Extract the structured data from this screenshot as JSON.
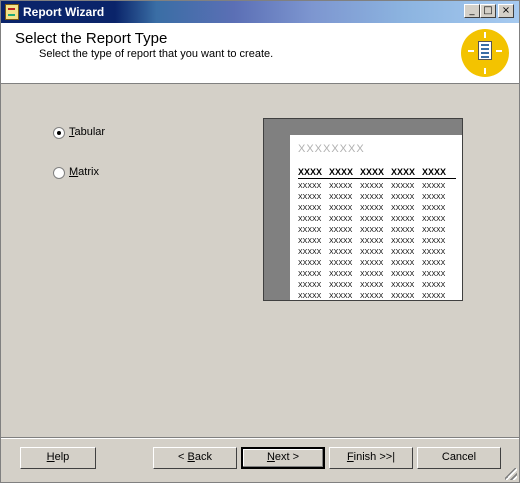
{
  "window": {
    "title": "Report Wizard",
    "controls": {
      "minimize": "_",
      "maximize": "□",
      "close": "×"
    }
  },
  "header": {
    "title": "Select the Report Type",
    "subtitle": "Select the type of report that you want to create."
  },
  "options": [
    {
      "label_prefix": "",
      "label_mnemonic": "T",
      "label_rest": "abular",
      "checked": true
    },
    {
      "label_prefix": "",
      "label_mnemonic": "M",
      "label_rest": "atrix",
      "checked": false
    }
  ],
  "preview": {
    "title": "XXXXXXXX",
    "headers": [
      "XXXX",
      "XXXX",
      "XXXX",
      "XXXX",
      "XXXX"
    ],
    "cell": "XXXXX",
    "row_count": 11
  },
  "buttons": {
    "help": {
      "mnemonic": "H",
      "rest": "elp"
    },
    "back": {
      "prefix": "< ",
      "mnemonic": "B",
      "rest": "ack"
    },
    "next": {
      "prefix": "",
      "mnemonic": "N",
      "rest": "ext >"
    },
    "finish": {
      "prefix": "",
      "mnemonic": "F",
      "rest": "inish >>|"
    },
    "cancel": {
      "label": "Cancel"
    }
  }
}
